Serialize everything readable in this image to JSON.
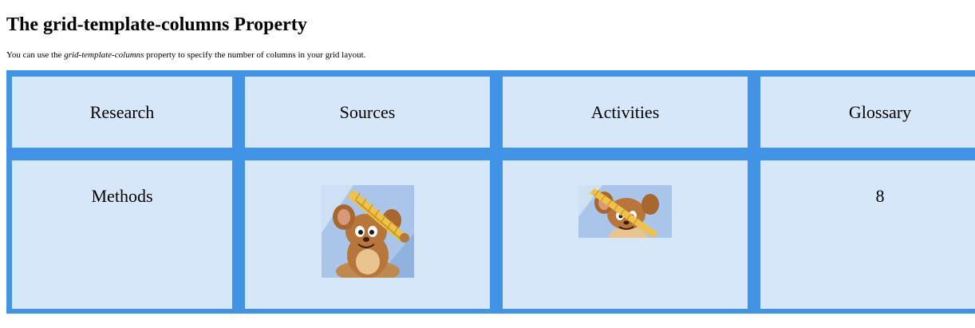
{
  "page": {
    "title": "The grid-template-columns Property",
    "intro_before": "You can use the ",
    "intro_em": "grid-template-columns",
    "intro_after": " property to specify the number of columns in your grid layout."
  },
  "grid": {
    "items": [
      {
        "label": "Research"
      },
      {
        "label": "Sources"
      },
      {
        "label": "Activities"
      },
      {
        "label": "Glossary"
      },
      {
        "label": "Methods"
      },
      {
        "image": "cartoon-mouse-with-comb"
      },
      {
        "image": "cartoon-mouse-with-comb"
      },
      {
        "label": "8"
      }
    ]
  },
  "colors": {
    "grid_background": "#4193e5",
    "cell_background": "#d5e7f9"
  }
}
